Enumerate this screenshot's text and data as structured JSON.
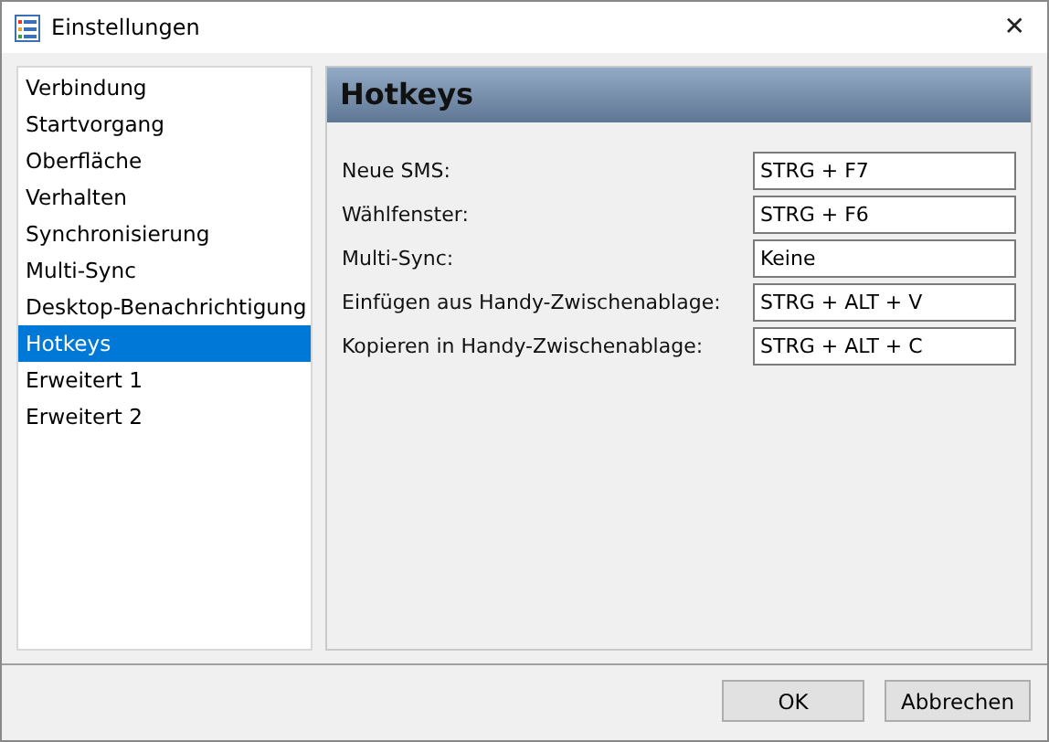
{
  "window": {
    "title": "Einstellungen",
    "close": "✕"
  },
  "sidebar": {
    "items": [
      {
        "label": "Verbindung",
        "selected": false
      },
      {
        "label": "Startvorgang",
        "selected": false
      },
      {
        "label": "Oberfläche",
        "selected": false
      },
      {
        "label": "Verhalten",
        "selected": false
      },
      {
        "label": "Synchronisierung",
        "selected": false
      },
      {
        "label": "Multi-Sync",
        "selected": false
      },
      {
        "label": "Desktop-Benachrichtigung",
        "selected": false
      },
      {
        "label": "Hotkeys",
        "selected": true
      },
      {
        "label": "Erweitert 1",
        "selected": false
      },
      {
        "label": "Erweitert 2",
        "selected": false
      }
    ]
  },
  "panel": {
    "title": "Hotkeys",
    "rows": [
      {
        "label": "Neue SMS:",
        "value": "STRG + F7"
      },
      {
        "label": "Wählfenster:",
        "value": "STRG + F6"
      },
      {
        "label": "Multi-Sync:",
        "value": "Keine"
      },
      {
        "label": "Einfügen aus Handy-Zwischenablage:",
        "value": "STRG + ALT + V"
      },
      {
        "label": "Kopieren in Handy-Zwischenablage:",
        "value": "STRG + ALT + C"
      }
    ]
  },
  "buttons": [
    "OK",
    "Abbrechen"
  ]
}
